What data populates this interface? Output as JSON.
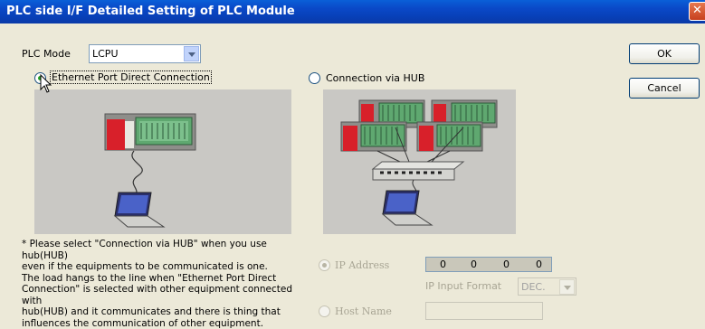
{
  "window": {
    "title": "PLC side I/F Detailed Setting of PLC Module",
    "close_glyph": "✕"
  },
  "plc_mode": {
    "label": "PLC Mode",
    "value": "LCPU"
  },
  "connection": {
    "direct_label": "Ethernet Port Direct Connection",
    "hub_label": "Connection via HUB",
    "selected": "direct"
  },
  "buttons": {
    "ok": "OK",
    "cancel": "Cancel"
  },
  "note_lines": [
    "* Please select \"Connection via HUB\" when you use hub(HUB)",
    "even if the equipments to be communicated is one.",
    "The load hangs to the line when \"Ethernet Port Direct",
    "Connection\" is selected with other equipment connected with",
    "hub(HUB) and it communicates and there is thing that",
    "influences the communication of other equipment."
  ],
  "ip": {
    "ip_address_label": "IP Address",
    "octets": [
      "0",
      "0",
      "0",
      "0"
    ],
    "input_format_label": "IP Input Format",
    "input_format_value": "DEC.",
    "host_name_label": "Host Name",
    "host_name_value": ""
  },
  "colors": {
    "title_bar": "#0a49c8",
    "dialog_bg": "#ece9d8",
    "panel_bg": "#c9c8c4",
    "plc_red": "#d8202a",
    "plc_green": "#5fa870"
  }
}
